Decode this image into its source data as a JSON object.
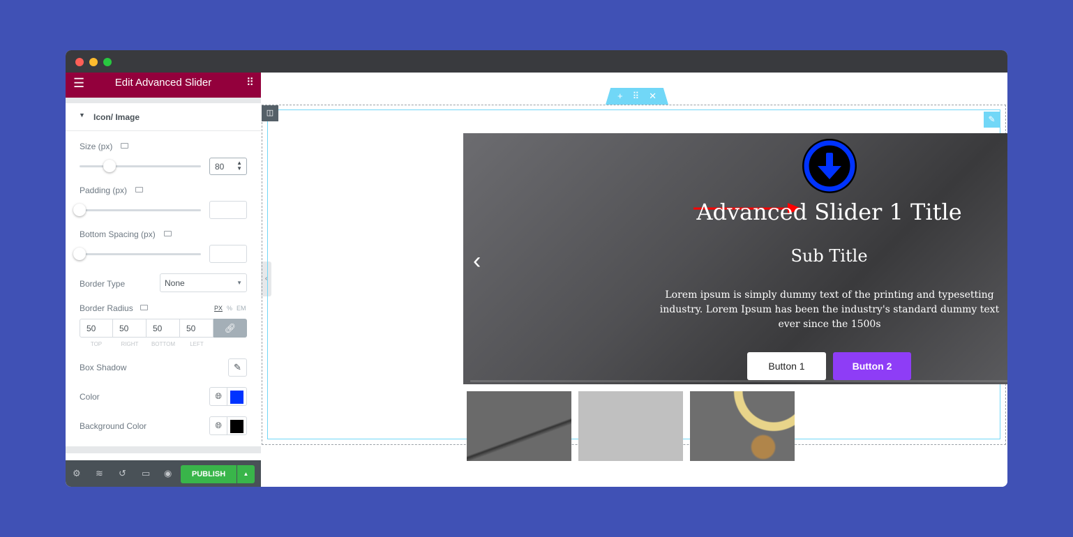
{
  "window": {
    "controls": [
      "close",
      "minimize",
      "maximize"
    ],
    "colors": {
      "close": "#fe5f57",
      "minimize": "#febc2e",
      "maximize": "#28c840"
    }
  },
  "sidebar": {
    "title": "Edit Advanced Slider",
    "section": "Icon/ Image",
    "size": {
      "label": "Size (px)",
      "value": "80",
      "slider_fraction": 0.25
    },
    "padding": {
      "label": "Padding (px)",
      "value": "",
      "slider_fraction": 0
    },
    "bottom_spacing": {
      "label": "Bottom Spacing (px)",
      "value": "",
      "slider_fraction": 0
    },
    "border_type": {
      "label": "Border Type",
      "value": "None"
    },
    "border_radius": {
      "label": "Border Radius",
      "units": [
        "PX",
        "%",
        "EM"
      ],
      "values": [
        "50",
        "50",
        "50",
        "50"
      ],
      "sides": [
        "TOP",
        "RIGHT",
        "BOTTOM",
        "LEFT"
      ]
    },
    "box_shadow": {
      "label": "Box Shadow"
    },
    "color": {
      "label": "Color",
      "swatch": "#0033ff"
    },
    "background_color": {
      "label": "Background Color",
      "swatch": "#000000"
    },
    "footer": {
      "publish": "PUBLISH"
    }
  },
  "canvas": {
    "slide": {
      "title": "Advanced Slider 1 Title",
      "subtitle": "Sub Title",
      "description": "Lorem ipsum is simply dummy text of the printing and typesetting industry. Lorem Ipsum has been the industry's standard dummy text ever since the 1500s",
      "button1": "Button 1",
      "button2": "Button 2",
      "icon": "arrow-down-circle-icon",
      "icon_color": "#0033ff",
      "icon_bg": "#000000",
      "progress_color": "#f0d66b"
    },
    "thumbnails": 3
  },
  "colors": {
    "header": "#93003c",
    "publish": "#39b54a",
    "button2": "#8e3df6",
    "accent": "#71d7f7"
  }
}
